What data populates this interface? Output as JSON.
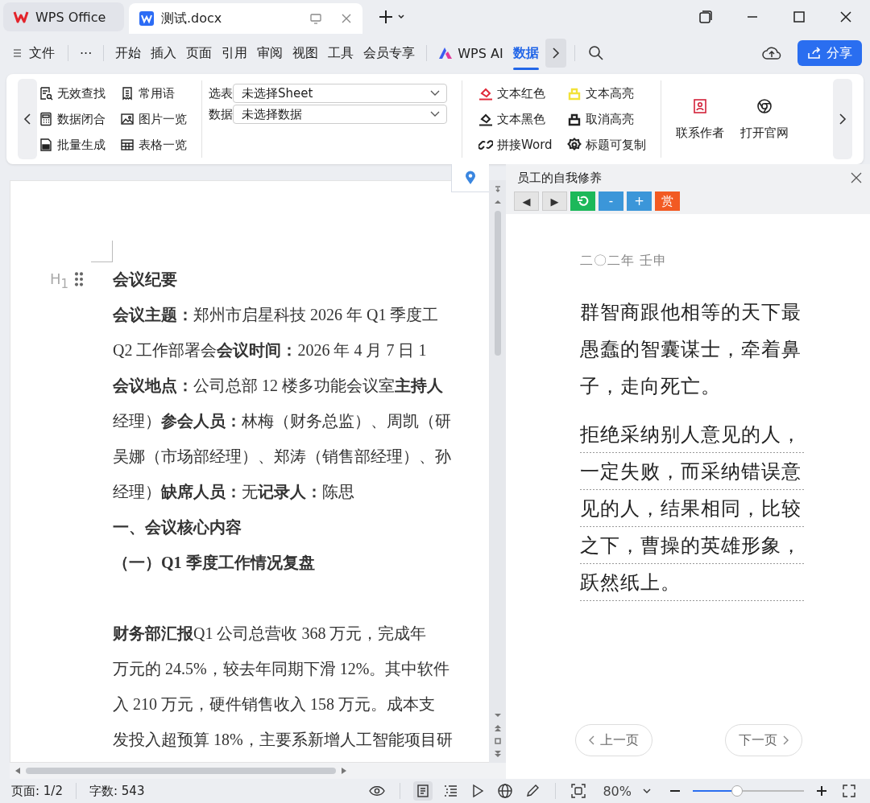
{
  "tabs": [
    {
      "label": "WPS Office",
      "selected": false
    },
    {
      "label": "测试.docx",
      "selected": true
    }
  ],
  "menu": {
    "file": "文件",
    "more": "···",
    "tabs": [
      {
        "label": "开始",
        "selected": false
      },
      {
        "label": "插入",
        "selected": false
      },
      {
        "label": "页面",
        "selected": false
      },
      {
        "label": "引用",
        "selected": false
      },
      {
        "label": "审阅",
        "selected": false
      },
      {
        "label": "视图",
        "selected": false
      },
      {
        "label": "工具",
        "selected": false
      },
      {
        "label": "会员专享",
        "selected": false
      },
      {
        "label": "WPS AI",
        "selected": false,
        "kind": "ai"
      },
      {
        "label": "数据",
        "selected": true
      }
    ],
    "share": "分享"
  },
  "ribbon": {
    "tools": [
      "无效查找",
      "数据闭合",
      "批量生成",
      "常用语",
      "图片一览",
      "表格一览"
    ],
    "selects": [
      {
        "label": "选表",
        "value": "未选择Sheet"
      },
      {
        "label": "数据",
        "value": "未选择数据"
      }
    ],
    "text_tools": [
      {
        "label": "文本红色",
        "color": "#e02a3a"
      },
      {
        "label": "文本黑色",
        "color": "#222222"
      },
      {
        "label": "拼接Word",
        "color": "#222222"
      },
      {
        "label": "文本高亮",
        "color": "#f2e23a"
      },
      {
        "label": "取消高亮",
        "color": "#222222"
      },
      {
        "label": "标题可复制",
        "color": "#222222"
      }
    ],
    "links": [
      "联系作者",
      "打开官网"
    ]
  },
  "document": {
    "heading_marker": "H$_{1}$",
    "lines": [
      {
        "text": "会议纪要",
        "kind": "heading"
      },
      {
        "text": "**会议主题：**郑州市启星科技 2026 年 Q1 季度工",
        "kind": "body"
      },
      {
        "text": "Q2 工作部署会**会议时间：**2026 年 4 月 7 日 1",
        "kind": "body"
      },
      {
        "text": "**会议地点：**公司总部 12 楼多功能会议室**主持人**",
        "kind": "body"
      },
      {
        "text": "经理）**参会人员：**林梅（财务总监）、周凯（研",
        "kind": "body"
      },
      {
        "text": "吴娜（市场部经理）、郑涛（销售部经理）、孙",
        "kind": "body"
      },
      {
        "text": "经理）**缺席人员：**无**记录人：**陈思",
        "kind": "body"
      },
      {
        "text": "一、会议核心内容",
        "kind": "heading"
      },
      {
        "text": "（一）Q1 季度工作情况复盘",
        "kind": "heading"
      },
      {
        "text": "**财务部汇报**Q1 公司总营收 368 万元，完成年",
        "kind": "body",
        "space_before": true
      },
      {
        "text": "万元的 24.5%，较去年同期下滑 12%。其中软件",
        "kind": "body"
      },
      {
        "text": "入 210 万元，硬件销售收入 158 万元。成本支",
        "kind": "body"
      },
      {
        "text": "发投入超预算 18%，主要系新增人工智能项目研",
        "kind": "body"
      }
    ]
  },
  "reader": {
    "title": "员工的自我修养",
    "controls": [
      {
        "kind": "nav",
        "label": "◀",
        "color": "#e4e4e4"
      },
      {
        "kind": "nav",
        "label": "▶",
        "color": "#e4e4e4"
      },
      {
        "kind": "refresh",
        "color": "#1cb85a"
      },
      {
        "kind": "text",
        "label": "-",
        "color": "#3b96d9"
      },
      {
        "kind": "text",
        "label": "+",
        "color": "#3b96d9"
      },
      {
        "kind": "text",
        "label": "赏",
        "color": "#f25a22"
      }
    ],
    "date": "二〇二年 壬申",
    "paragraphs": [
      {
        "text": "群智商跟他相等的天下最愚蠢的智囊谋士，牵着鼻子，走向死亡。",
        "underlined": false
      },
      {
        "text": "拒绝采纳别人意见的人，一定失败，而采纳错误意见的人，结果相同，比较之下，曹操的英雄形象，跃然纸上。",
        "underlined": true
      }
    ],
    "prev": "上一页",
    "next": "下一页"
  },
  "status_bar": {
    "page": "页面: 1/2",
    "words": "字数: 543",
    "zoom": "80%",
    "zoom_slider": {
      "level": 0.4
    }
  }
}
